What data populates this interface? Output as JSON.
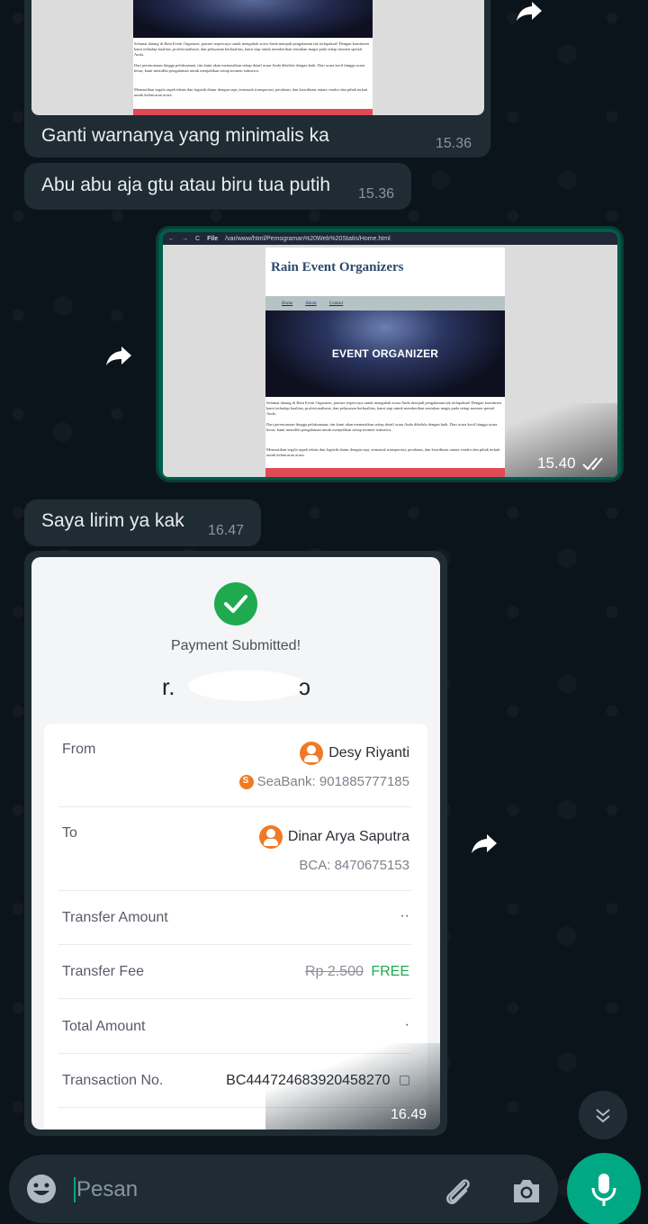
{
  "messages": {
    "m1": {
      "text": "Ganti warnanya yang minimalis ka",
      "time": "15.36"
    },
    "m2": {
      "text": "Abu abu aja gtu atau biru tua putih",
      "time": "15.36"
    },
    "m3": {
      "time": "15.40"
    },
    "m4": {
      "text": "Saya lirim ya kak",
      "time": "16.47"
    },
    "m5": {
      "time": "16.49"
    }
  },
  "browser": {
    "url": "/var/www/html/Pemograman%20Web%20Statis/Home.html",
    "file_label": "File"
  },
  "website": {
    "title": "Rain Event Organizers",
    "nav": [
      "Home",
      "About",
      "Contact"
    ],
    "hero_text": "EVENT ORGANIZER",
    "para1": "Selamat datang di Rain Event Organizer, partner terpercaya untuk mengubah acara Anda menjadi pengalaman tak terlupakan! Dengan komitmen kami terhadap kualitas, profesionalisme, dan pelayanan berkualitas, kami siap untuk memberikan sentuhan magis pada setiap momen spesial Anda.",
    "para2": "Dari perencanaan hingga pelaksanaan, tim kami akan memastikan setiap detail acara Anda dikelola dengan baik. Dari acara kecil hingga acara besar, kami memiliki pengalaman untuk menjadikan setiap momen istimewa.",
    "para3": "Memastikan segala aspek teknis dan logistik diatur dengan rapi, termasuk transportasi, peralatan, dan koordinasi antara vendor dan pihak terkait untuk kelancaran acara.",
    "top_para1": "Selamat datang di Rain Event Organizer, partner terpercaya untuk mengubah acara Anda menjadi pengalaman tak terlupakan! Dengan komitmen kami terhadap kualitas, profesionalisme, dan pelayanan berkualitas, kami siap untuk memberikan sentuhan magis pada setiap momen spesial Anda.",
    "top_para2": "Dari perencanaan hingga pelaksanaan, tim kami akan memastikan setiap detail acara Anda dikelola dengan baik. Dari acara kecil hingga acara besar, kami memiliki pengalaman untuk menjadikan setiap momen istimewa.",
    "top_para3": "Memastikan segala aspek teknis dan logistik diatur dengan rapi, termasuk transportasi, peralatan, dan koordinasi antara vendor dan pihak terkait untuk kelancaran acara."
  },
  "receipt": {
    "status": "Payment Submitted!",
    "from_label": "From",
    "from_name": "Desy Riyanti",
    "from_bank": "SeaBank: 901885777185",
    "to_label": "To",
    "to_name": "Dinar Arya Saputra",
    "to_bank": "BCA: 8470675153",
    "transfer_amount_label": "Transfer Amount",
    "transfer_fee_label": "Transfer Fee",
    "transfer_fee_old": "Rp 2.500",
    "transfer_fee_new": "FREE",
    "total_label": "Total Amount",
    "txn_label": "Transaction No.",
    "txn_value": "BC444724683920458270"
  },
  "composer": {
    "placeholder": "Pesan"
  },
  "colors": {
    "bg": "#0b141a",
    "bubble_in": "#202c33",
    "bubble_out": "#005c4b",
    "accent": "#00a884",
    "success": "#1faa4f",
    "free_text": "#1faa4f"
  }
}
